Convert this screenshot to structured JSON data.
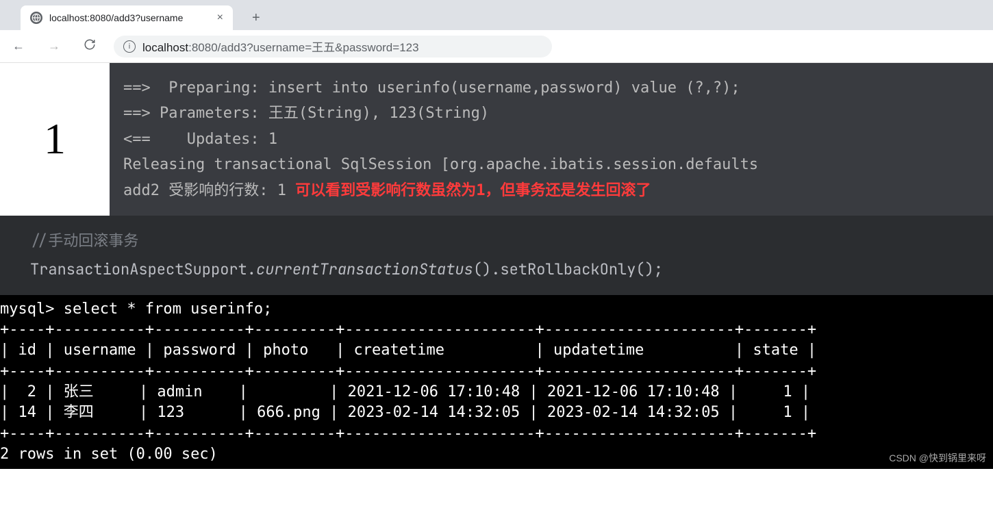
{
  "browser": {
    "tab_title": "localhost:8080/add3?username",
    "url_host": "localhost",
    "url_rest": ":8080/add3?username=王五&password=123"
  },
  "section1": {
    "num": "1",
    "log": "==>  Preparing: insert into userinfo(username,password) value (?,?);\n==> Parameters: 王五(String), 123(String)\n<==    Updates: 1\nReleasing transactional SqlSession [org.apache.ibatis.session.defaults",
    "affected_line_prefix": "add2 受影响的行数: 1 ",
    "red_note": "可以看到受影响行数虽然为1，但事务还是发生回滚了"
  },
  "section2": {
    "comment": "//手动回滚事务",
    "code_prefix": "TransactionAspectSupport.",
    "code_method": "currentTransactionStatus",
    "code_suffix": "().setRollbackOnly();"
  },
  "section3": {
    "prompt": "mysql> select * from userinfo;",
    "divider": "+----+----------+----------+---------+---------------------+---------------------+-------+",
    "header": "| id | username | password | photo   | createtime          | updatetime          | state |",
    "row1": "|  2 | 张三     | admin    |         | 2021-12-06 17:10:48 | 2021-12-06 17:10:48 |     1 |",
    "row2": "| 14 | 李四     | 123      | 666.png | 2023-02-14 14:32:05 | 2023-02-14 14:32:05 |     1 |",
    "footer": "2 rows in set (0.00 sec)",
    "watermark": "CSDN @快到锅里来呀"
  }
}
